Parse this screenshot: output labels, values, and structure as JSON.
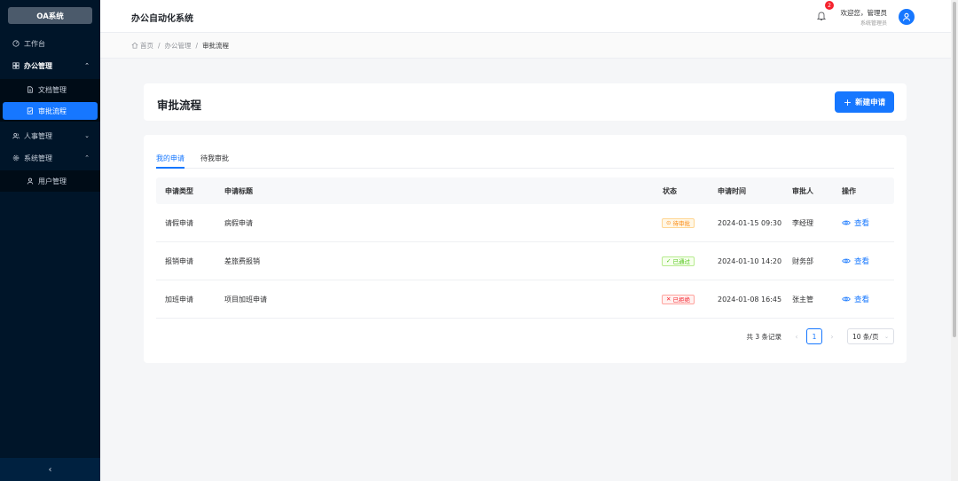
{
  "sidebar": {
    "logo": "OA系统",
    "items": [
      {
        "label": "工作台",
        "icon": "dashboard-icon"
      },
      {
        "label": "办公管理",
        "icon": "grid-icon",
        "expanded": true
      },
      {
        "label": "文档管理",
        "icon": "document-icon"
      },
      {
        "label": "审批流程",
        "icon": "approval-icon",
        "active": true
      },
      {
        "label": "人事管理",
        "icon": "users-icon",
        "expanded": false
      },
      {
        "label": "系统管理",
        "icon": "gear-icon",
        "expanded": true
      },
      {
        "label": "用户管理",
        "icon": "user-icon"
      }
    ],
    "collapse_icon": "‹"
  },
  "header": {
    "title": "办公自动化系统",
    "notification_count": "2",
    "welcome": "欢迎您，管理员",
    "role": "系统管理员"
  },
  "breadcrumb": {
    "items": [
      "首页",
      "办公管理",
      "审批流程"
    ],
    "separator": "/"
  },
  "page": {
    "title": "审批流程",
    "new_button": "新建申请",
    "new_button_icon": "+"
  },
  "tabs": [
    "我的申请",
    "待我审批"
  ],
  "table": {
    "headers": [
      "申请类型",
      "申请标题",
      "状态",
      "申请时间",
      "审批人",
      "操作"
    ],
    "rows": [
      {
        "type": "请假申请",
        "title": "病假申请",
        "status": "待审批",
        "status_icon": "⊙",
        "time": "2024-01-15 09:30",
        "approver": "李经理",
        "action": "查看"
      },
      {
        "type": "报销申请",
        "title": "差旅费报销",
        "status": "已通过",
        "status_icon": "✓",
        "time": "2024-01-10 14:20",
        "approver": "财务部",
        "action": "查看"
      },
      {
        "type": "加班申请",
        "title": "项目加班申请",
        "status": "已拒绝",
        "status_icon": "✕",
        "time": "2024-01-08 16:45",
        "approver": "张主管",
        "action": "查看"
      }
    ]
  },
  "pagination": {
    "total": "共 3 条记录",
    "current": "1",
    "prev": "‹",
    "next": "›",
    "page_size": "10 条/页"
  },
  "colors": {
    "primary": "#1677ff",
    "sidebar_bg": "#001529",
    "pending": "#fa8c16",
    "approved": "#52c41a",
    "rejected": "#f5222d"
  }
}
